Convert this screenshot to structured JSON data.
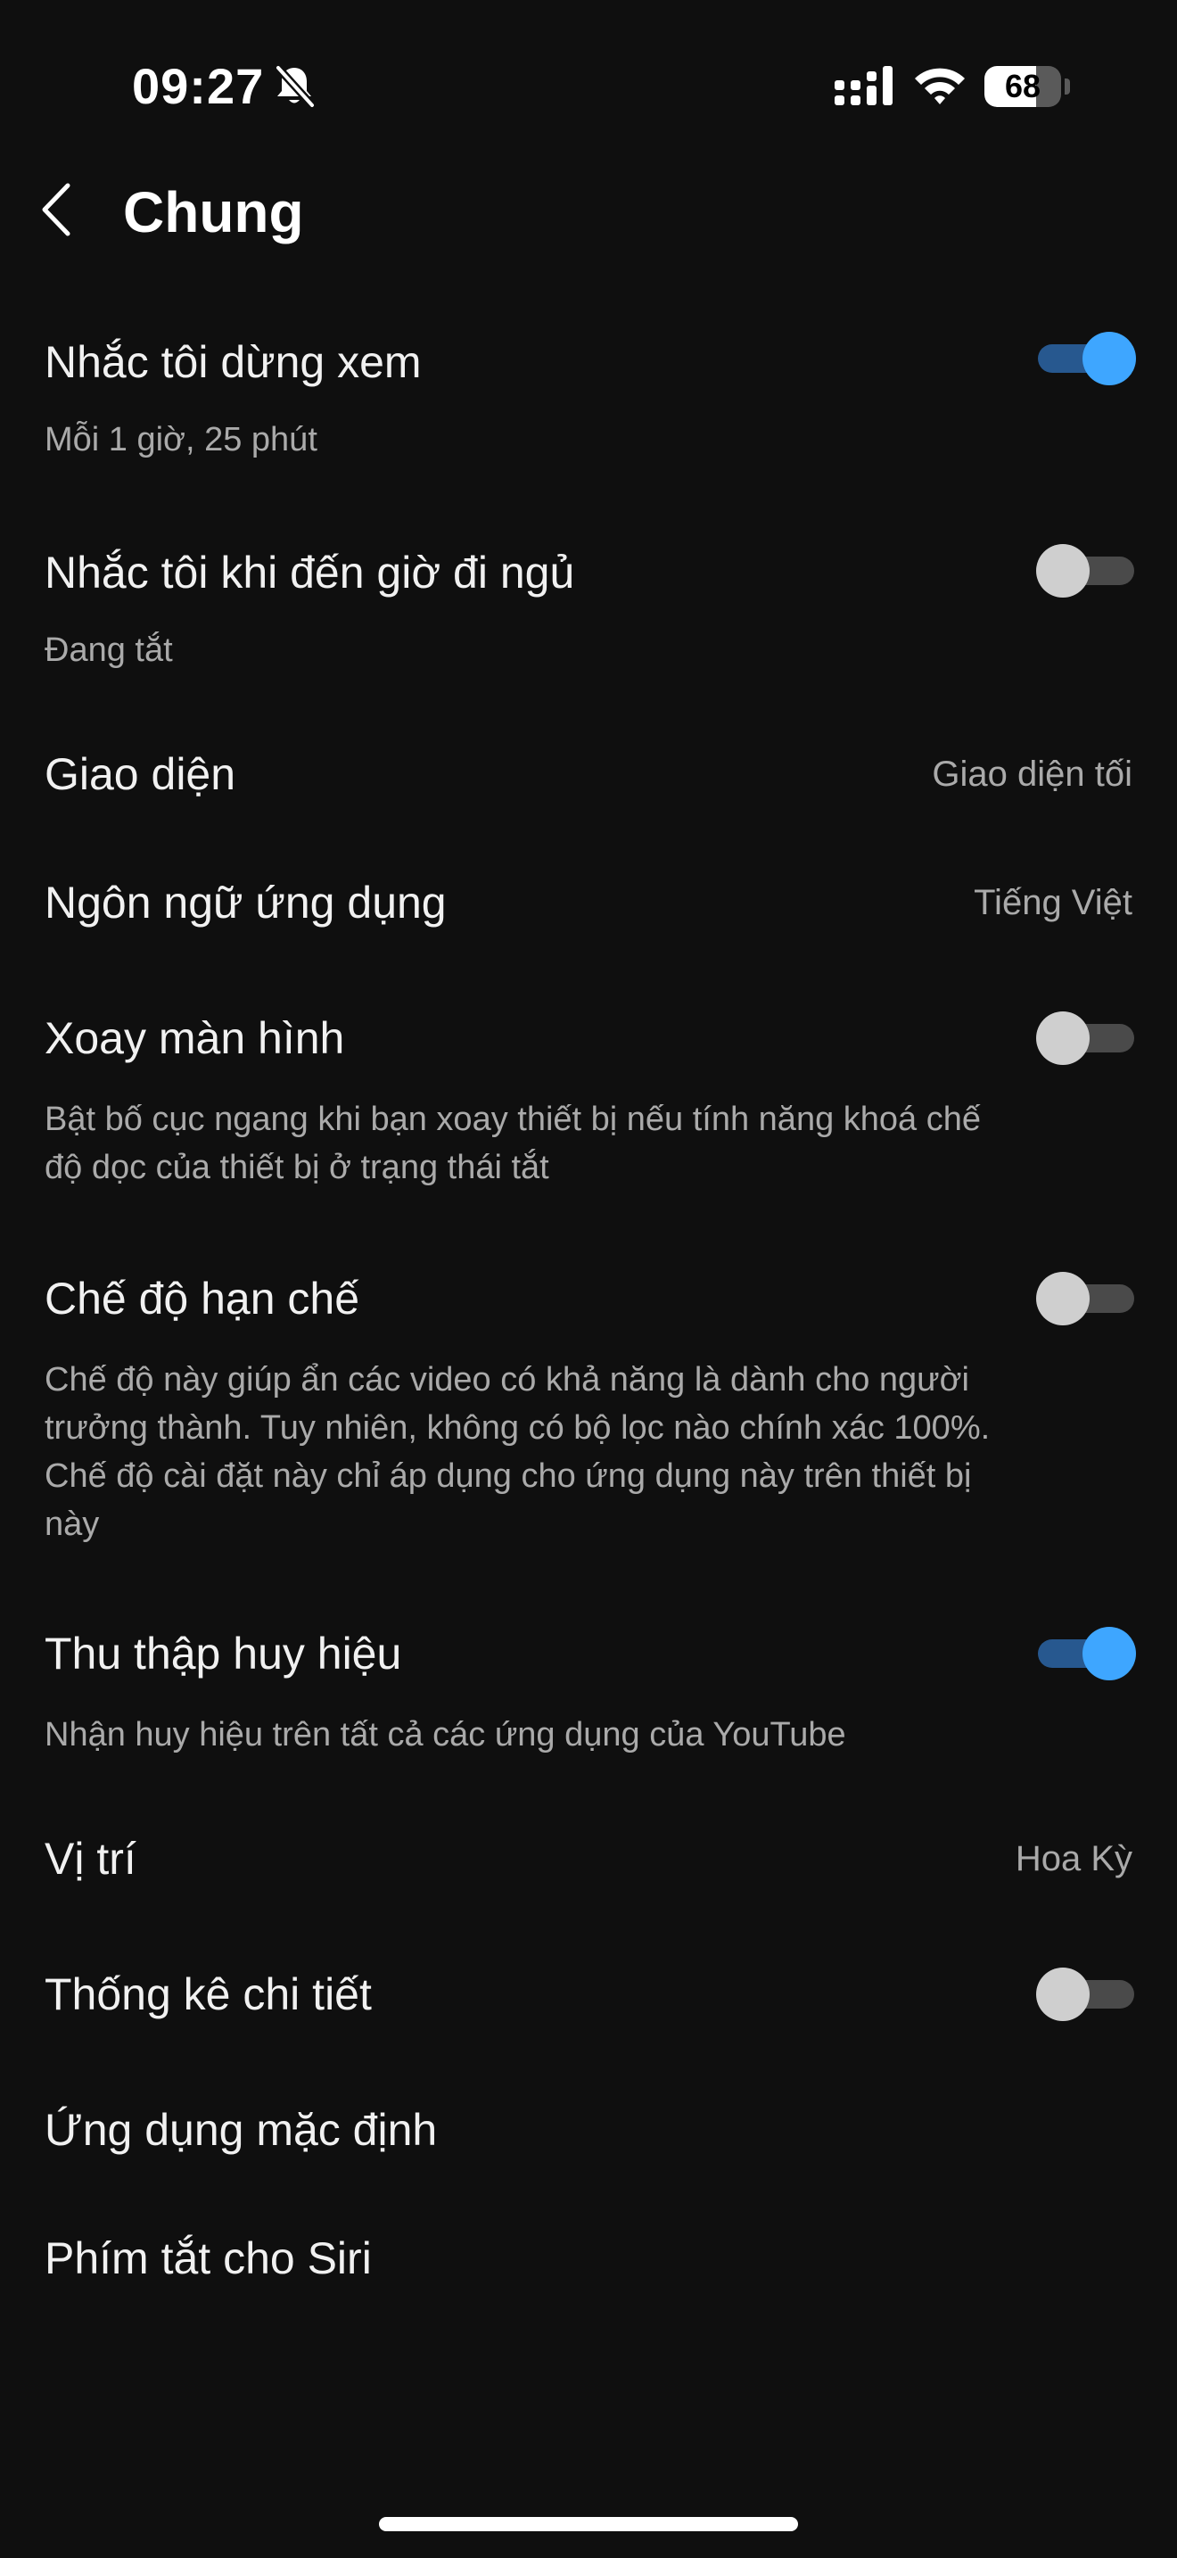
{
  "status_bar": {
    "time": "09:27",
    "silent_icon": "bell-slash-icon",
    "signal_icon": "cellular-signal-icon",
    "wifi_icon": "wifi-icon",
    "battery_level": 68,
    "battery_label": "68"
  },
  "header": {
    "back_icon": "chevron-left-icon",
    "title": "Chung"
  },
  "colors": {
    "background": "#0f0f0f",
    "toggle_on_thumb": "#3ea6ff",
    "toggle_on_track": "#27588f",
    "toggle_off_thumb": "#cfcfcf",
    "toggle_off_track": "#4a4a4a"
  },
  "settings": {
    "remind_break": {
      "title": "Nhắc tôi dừng xem",
      "subtitle": "Mỗi 1 giờ, 25 phút",
      "toggle_on": true
    },
    "remind_bedtime": {
      "title": "Nhắc tôi khi đến giờ đi ngủ",
      "subtitle": "Đang tắt",
      "toggle_on": false
    },
    "appearance": {
      "title": "Giao diện",
      "value": "Giao diện tối"
    },
    "app_language": {
      "title": "Ngôn ngữ ứng dụng",
      "value": "Tiếng Việt"
    },
    "rotate_screen": {
      "title": "Xoay màn hình",
      "subtitle": "Bật bố cục ngang khi bạn xoay thiết bị nếu tính năng khoá chế độ dọc của thiết bị ở trạng thái tắt",
      "toggle_on": false
    },
    "restricted_mode": {
      "title": "Chế độ hạn chế",
      "subtitle": "Chế độ này giúp ẩn các video có khả năng là dành cho người trưởng thành. Tuy nhiên, không có bộ lọc nào chính xác 100%. Chế độ cài đặt này chỉ áp dụng cho ứng dụng này trên thiết bị này",
      "toggle_on": false
    },
    "collect_badges": {
      "title": "Thu thập huy hiệu",
      "subtitle": "Nhận huy hiệu trên tất cả các ứng dụng của YouTube",
      "toggle_on": true
    },
    "location": {
      "title": "Vị trí",
      "value": "Hoa Kỳ"
    },
    "stats_for_nerds": {
      "title": "Thống kê chi tiết",
      "toggle_on": false
    },
    "default_apps": {
      "title": "Ứng dụng mặc định"
    },
    "siri_shortcuts": {
      "title": "Phím tắt cho Siri"
    }
  }
}
